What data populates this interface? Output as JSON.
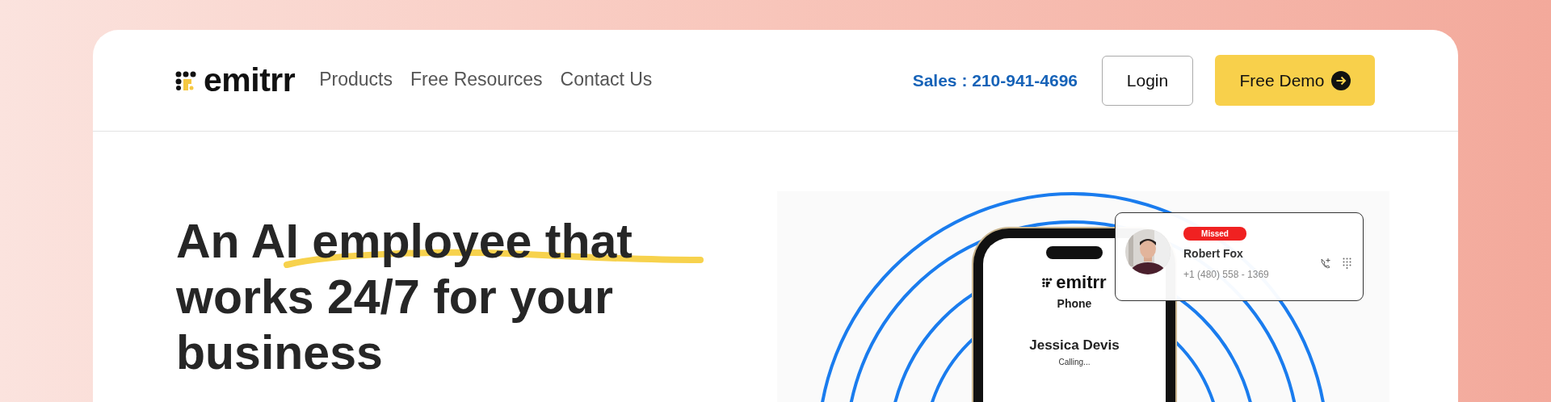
{
  "nav": {
    "logo": "emitrr",
    "links": [
      "Products",
      "Free Resources",
      "Contact Us"
    ]
  },
  "sales": "Sales : 210-941-4696",
  "buttons": [
    {
      "label": "Login",
      "kind": "outline"
    },
    {
      "label": "Free Demo",
      "kind": "primary"
    }
  ],
  "hero": {
    "headline": "An AI employee that works 24/7 for your business"
  },
  "phone": {
    "logo": "emitrr",
    "app": "Phone",
    "caller": "Jessica Devis",
    "status": "Calling..."
  },
  "call_card": {
    "badge": "Missed",
    "name": "Robert Fox",
    "number": "+1 (480) 558 - 1369"
  }
}
